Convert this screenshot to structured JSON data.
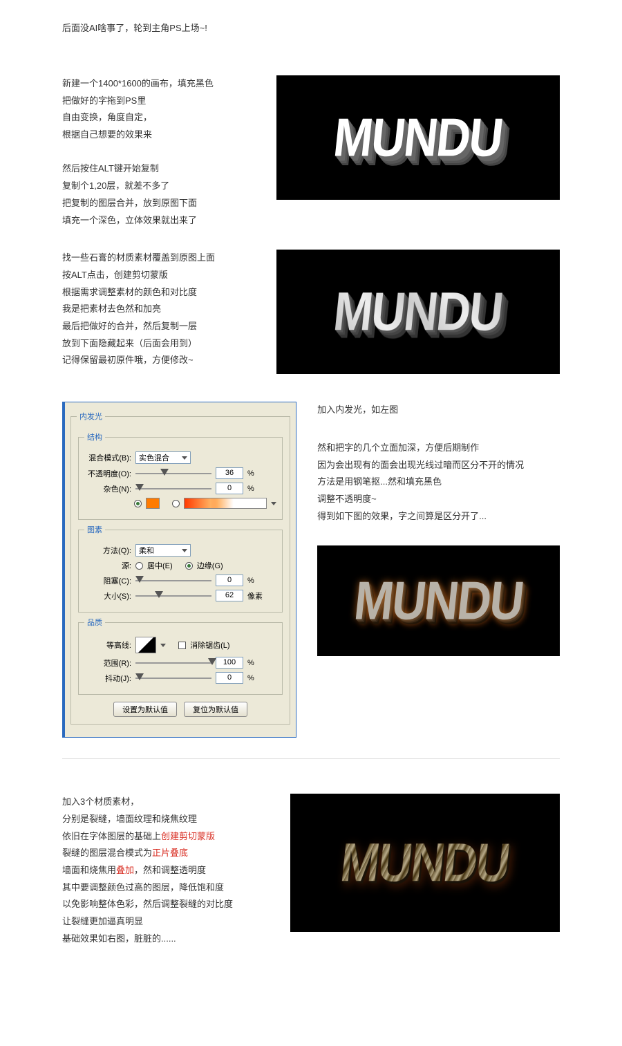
{
  "intro": "后面没AI啥事了，轮到主角PS上场~!",
  "block1": {
    "lines": [
      "新建一个1400*1600的画布，填充黑色",
      "把做好的字拖到PS里",
      "自由变换，角度自定，",
      "根据自己想要的效果来",
      "",
      "然后按住ALT键开始复制",
      "复制个1,20层，就差不多了",
      "把复制的图层合并，放到原图下面",
      "填充一个深色，立体效果就出来了"
    ]
  },
  "block2": {
    "lines": [
      "找一些石膏的材质素材覆盖到原图上面",
      "按ALT点击，创建剪切蒙版",
      "根据需求调整素材的颜色和对比度",
      "我是把素材去色然和加亮",
      "最后把做好的合并，然后复制一层",
      "放到下面隐藏起来（后面会用到）",
      "记得保留最初原件哦，方便修改~"
    ]
  },
  "dialog": {
    "group_inner_glow": "内发光",
    "group_struct": "结构",
    "blend_mode_label": "混合模式(B):",
    "blend_mode_value": "实色混合",
    "opacity_label": "不透明度(O):",
    "opacity_value": "36",
    "opacity_unit": "%",
    "noise_label": "杂色(N):",
    "noise_value": "0",
    "noise_unit": "%",
    "group_elements": "图素",
    "technique_label": "方法(Q):",
    "technique_value": "柔和",
    "source_label": "源:",
    "source_center": "居中(E)",
    "source_edge": "边缘(G)",
    "choke_label": "阻塞(C):",
    "choke_value": "0",
    "choke_unit": "%",
    "size_label": "大小(S):",
    "size_value": "62",
    "size_unit": "像素",
    "group_quality": "品质",
    "contour_label": "等高线:",
    "antialias_label": "消除锯齿(L)",
    "range_label": "范围(R):",
    "range_value": "100",
    "range_unit": "%",
    "jitter_label": "抖动(J):",
    "jitter_value": "0",
    "jitter_unit": "%",
    "btn_default": "设置为默认值",
    "btn_reset": "复位为默认值"
  },
  "right1": "加入内发光，如左图",
  "right2": "然和把字的几个立面加深，方便后期制作\n因为会出现有的面会出现光线过暗而区分不开的情况\n方法是用钢笔抠...然和填充黑色\n调整不透明度~\n得到如下图的效果，字之间算是区分开了...",
  "last": {
    "line1": "加入3个材质素材，",
    "line2": "分别是裂缝，墙面纹理和烧焦纹理",
    "line3a": "依旧在字体图层的基础上",
    "line3b": "创建剪切蒙版",
    "line4a": "裂缝的图层混合模式为",
    "line4b": "正片叠底",
    "line5a": "墙面和烧焦用",
    "line5b": "叠加",
    "line5c": "，然和调整透明度",
    "line6": "其中要调整颜色过高的图层，降低饱和度",
    "line7": "以免影响整体色彩，然后调整裂缝的对比度",
    "line8": "让裂缝更加逼真明显",
    "line9": "基础效果如右图，脏脏的......"
  },
  "logo_text": "MUNDU"
}
